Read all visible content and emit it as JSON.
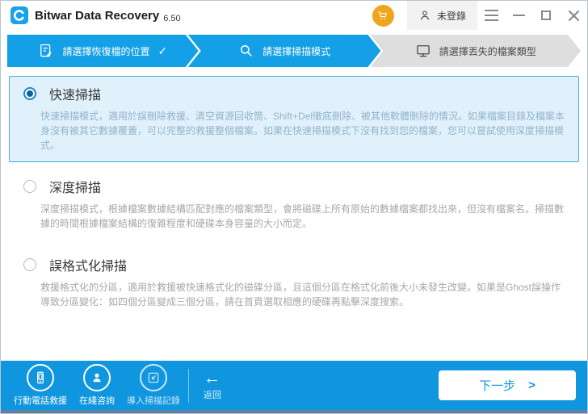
{
  "titlebar": {
    "app_name": "Bitwar Data Recovery",
    "version": "6.50",
    "login_label": "未登錄"
  },
  "steps": [
    {
      "label": "請選擇恢復檔的位置",
      "icon": "document-edit-icon",
      "state": "done"
    },
    {
      "label": "請選擇掃描模式",
      "icon": "search-icon",
      "state": "active"
    },
    {
      "label": "請選擇丟失的檔案類型",
      "icon": "monitor-icon",
      "state": "upcoming"
    }
  ],
  "scan_modes": [
    {
      "title": "快速掃描",
      "selected": true,
      "description": "快速掃描模式，適用於誤刪除救援、清空資源回收筒、Shift+Del徹底刪除、被其他軟體刪除的情況。如果檔案目錄及檔案本身沒有被其它數據覆蓋，可以完整的救援整個檔案。如果在快速掃描模式下沒有找到您的檔案，您可以嘗試使用深度掃描模式。"
    },
    {
      "title": "深度掃描",
      "selected": false,
      "description": "深度掃描模式，根據檔案數據結構匹配對應的檔案類型，會將磁碟上所有原始的數據檔案都找出來，但沒有檔案名。掃描數據的時間根據檔案結構的復雜程度和硬碟本身容量的大小而定。"
    },
    {
      "title": "誤格式化掃描",
      "selected": false,
      "description": "救援格式化的分區，適用於救援被快速格式化的磁碟分區，且這個分區在格式化前後大小未發生改變。如果是Ghost誤操作導致分區變化：如四個分區變成三個分區，請在首頁選取相應的硬碟再點擊深度搜索。"
    }
  ],
  "footer": {
    "tools": [
      {
        "label": "行動電話救援",
        "icon": "mobile-phone-icon"
      },
      {
        "label": "在綫咨詢",
        "icon": "support-person-icon"
      },
      {
        "label": "導入掃描記錄",
        "icon": "import-record-icon"
      }
    ],
    "back_label": "返回",
    "next_label": "下一步"
  },
  "icons": {
    "check": "✓",
    "back_arrow": "←",
    "next_chevron": ">"
  },
  "colors": {
    "primary_blue": "#14a0e6",
    "footer_blue": "#0f96de",
    "cart_orange": "#efa51d",
    "selected_box_bg": "#e1f1fb",
    "selected_box_border": "#4aa9d9",
    "inactive_step_gray": "#dedede"
  }
}
